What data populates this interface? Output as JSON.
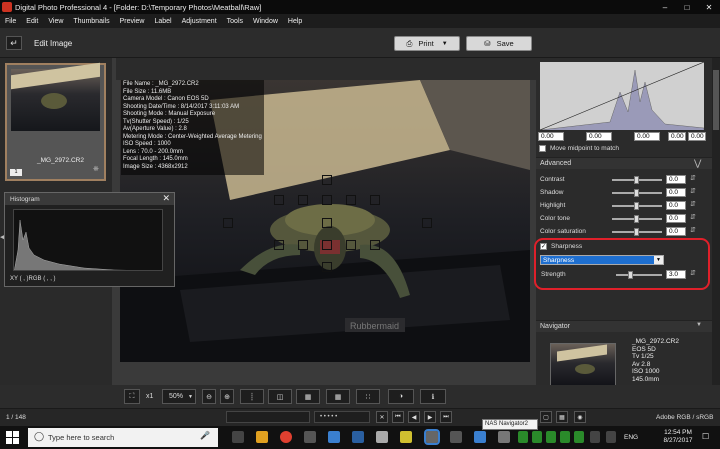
{
  "window": {
    "title": "Digital Photo Professional 4 - [Folder: D:\\Temporary Photos\\Meatball\\Raw]"
  },
  "menu": [
    "File",
    "Edit",
    "View",
    "Thumbnails",
    "Preview",
    "Label",
    "Adjustment",
    "Tools",
    "Window",
    "Help"
  ],
  "toolbar": {
    "edit_image_label": "Edit Image",
    "print_label": "Print",
    "save_label": "Save"
  },
  "thumbnail": {
    "filename": "_MG_2972.CR2",
    "badge": "1"
  },
  "info": [
    "File Name : _MG_2972.CR2",
    "File Size : 11.6MB",
    "Camera Model : Canon EOS 5D",
    "Shooting Date/Time : 8/14/2017 3:11:03 AM",
    "Shooting Mode : Manual Exposure",
    "Tv(Shutter Speed) : 1/25",
    "Av(Aperture Value) : 2.8",
    "Metering Mode : Center-Weighted Average Metering",
    "ISO Speed : 1000",
    "Lens : 70.0 - 200.0mm",
    "Focal Length : 145.0mm",
    "Image Size : 4368x2912"
  ],
  "histogram_panel": {
    "title": "Histogram",
    "readout": "XY (    ,    )RGB (    ,    ,    )"
  },
  "levels": {
    "values": [
      "0.00",
      "0.00",
      "0.00",
      "0.00",
      "0.00"
    ],
    "midpoint_label": "Move midpoint to match"
  },
  "advanced": {
    "title": "Advanced",
    "rows": [
      {
        "label": "Contrast",
        "value": "0.0",
        "pos": 0.5
      },
      {
        "label": "Shadow",
        "value": "0.0",
        "pos": 0.5
      },
      {
        "label": "Highlight",
        "value": "0.0",
        "pos": 0.5
      },
      {
        "label": "Color tone",
        "value": "0.0",
        "pos": 0.5
      },
      {
        "label": "Color saturation",
        "value": "0.0",
        "pos": 0.5
      }
    ]
  },
  "sharpness": {
    "checkbox_label": "Sharpness",
    "dropdown": "Sharpness",
    "strength_label": "Strength",
    "strength_value": "3.0",
    "strength_pos": 0.3
  },
  "navigator": {
    "title": "Navigator",
    "info": [
      "_MG_2972.CR2",
      "EOS 5D",
      "Tv 1/25",
      "Av 2.8",
      "ISO 1000",
      "145.0mm"
    ]
  },
  "bottom": {
    "zoom_x": "x1",
    "zoom_percent": "50%",
    "tooltip": "NAS Navigator2"
  },
  "status": {
    "count": "1 / 148",
    "colorspace": "Adobe RGB / sRGB"
  },
  "taskbar": {
    "search_placeholder": "Type here to search",
    "time": "12:54 PM",
    "date": "8/27/2017",
    "lang": "ENG"
  },
  "colors": {
    "highlight_ring": "#e0202a",
    "dropdown_blue": "#1e6fd0",
    "titlebar": "#0b0b0b"
  }
}
